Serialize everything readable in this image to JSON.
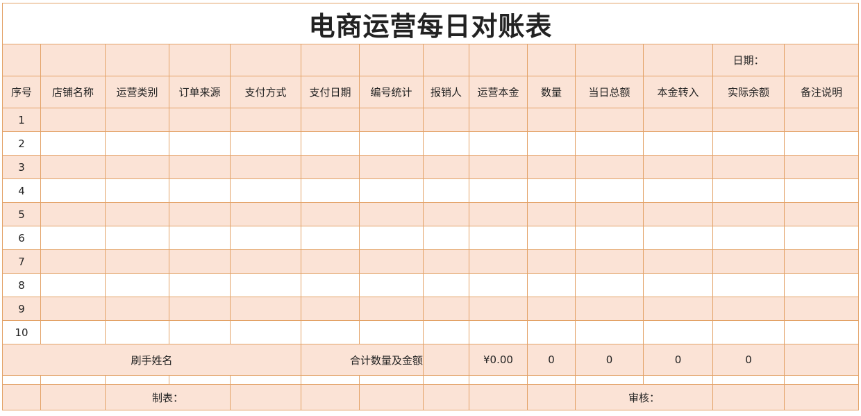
{
  "title": "电商运营每日对账表",
  "date_label": "日期：",
  "headers": [
    "序号",
    "店铺名称",
    "运营类别",
    "订单来源",
    "支付方式",
    "支付日期",
    "编号统计",
    "报销人",
    "运营本金",
    "数量",
    "当日总额",
    "本金转入",
    "实际余额",
    "备注说明"
  ],
  "rows": [
    {
      "no": "1"
    },
    {
      "no": "2"
    },
    {
      "no": "3"
    },
    {
      "no": "4"
    },
    {
      "no": "5"
    },
    {
      "no": "6"
    },
    {
      "no": "7"
    },
    {
      "no": "8"
    },
    {
      "no": "9"
    },
    {
      "no": "10"
    }
  ],
  "totals": {
    "swiper_label": "刷手姓名",
    "total_label": "合计数量及金额",
    "principal": "¥0.00",
    "quantity": "0",
    "daily_total": "0",
    "principal_in": "0",
    "actual_balance": "0"
  },
  "footer": {
    "maker_label": "制表：",
    "review_label": "审核："
  },
  "colors": {
    "border": "#e3a267",
    "peach": "#fbe3d6"
  }
}
